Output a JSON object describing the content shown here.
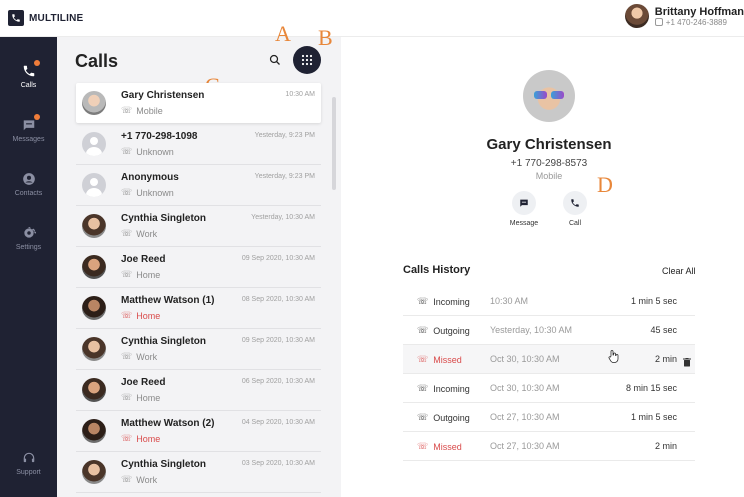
{
  "app": {
    "brand": "MULTILINE"
  },
  "user": {
    "name": "Brittany Hoffman",
    "phone": "+1 470-246-3889"
  },
  "sidebar": {
    "items": [
      {
        "label": "Calls",
        "icon": "phone-icon",
        "active": true,
        "badge": true
      },
      {
        "label": "Messages",
        "icon": "message-icon",
        "active": false,
        "badge": true
      },
      {
        "label": "Contacts",
        "icon": "contact-icon",
        "active": false,
        "badge": false
      },
      {
        "label": "Settings",
        "icon": "gear-icon",
        "active": false,
        "badge": false
      }
    ],
    "support_label": "Support"
  },
  "calls_list": {
    "title": "Calls",
    "items": [
      {
        "name": "Gary Christensen",
        "type": "Mobile",
        "time": "10:30 AM",
        "missed": false,
        "avatar": "photo"
      },
      {
        "name": "+1 770-298-1098",
        "type": "Unknown",
        "time": "Yesterday, 9:23 PM",
        "missed": false,
        "avatar": "empty"
      },
      {
        "name": "Anonymous",
        "type": "Unknown",
        "time": "Yesterday, 9:23 PM",
        "missed": false,
        "avatar": "empty"
      },
      {
        "name": "Cynthia Singleton",
        "type": "Work",
        "time": "Yesterday, 10:30 AM",
        "missed": false,
        "avatar": "photo"
      },
      {
        "name": "Joe Reed",
        "type": "Home",
        "time": "09 Sep 2020, 10:30 AM",
        "missed": false,
        "avatar": "photo"
      },
      {
        "name": "Matthew Watson (1)",
        "type": "Home",
        "time": "08 Sep 2020, 10:30 AM",
        "missed": true,
        "avatar": "photo"
      },
      {
        "name": "Cynthia Singleton",
        "type": "Work",
        "time": "09 Sep 2020, 10:30 AM",
        "missed": false,
        "avatar": "photo"
      },
      {
        "name": "Joe Reed",
        "type": "Home",
        "time": "06 Sep 2020, 10:30 AM",
        "missed": false,
        "avatar": "photo"
      },
      {
        "name": "Matthew Watson (2)",
        "type": "Home",
        "time": "04 Sep 2020, 10:30 AM",
        "missed": true,
        "avatar": "photo"
      },
      {
        "name": "Cynthia Singleton",
        "type": "Work",
        "time": "03 Sep 2020, 10:30 AM",
        "missed": false,
        "avatar": "photo"
      }
    ]
  },
  "annotations": {
    "a": "A",
    "b": "B",
    "c": "C",
    "d": "D"
  },
  "detail": {
    "name": "Gary Christensen",
    "phone": "+1 770-298-8573",
    "type": "Mobile",
    "actions": {
      "message": "Message",
      "call": "Call"
    },
    "history_title": "Calls History",
    "clear_all": "Clear All",
    "history": [
      {
        "type": "Incoming",
        "time": "10:30 AM",
        "duration": "1 min 5 sec",
        "missed": false
      },
      {
        "type": "Outgoing",
        "time": "Yesterday,  10:30 AM",
        "duration": "45 sec",
        "missed": false
      },
      {
        "type": "Missed",
        "time": "Oct 30, 10:30 AM",
        "duration": "2 min",
        "missed": true
      },
      {
        "type": "Incoming",
        "time": "Oct 30, 10:30 AM",
        "duration": "8 min 15 sec",
        "missed": false
      },
      {
        "type": "Outgoing",
        "time": "Oct 27, 10:30 AM",
        "duration": "1 min 5 sec",
        "missed": false
      },
      {
        "type": "Missed",
        "time": "Oct 27, 10:30 AM",
        "duration": "2 min",
        "missed": true
      }
    ]
  },
  "colors": {
    "sidebar": "#1f2233",
    "accent": "#f07d3a",
    "missed": "#d94b4b",
    "marker": "#e8873a"
  }
}
